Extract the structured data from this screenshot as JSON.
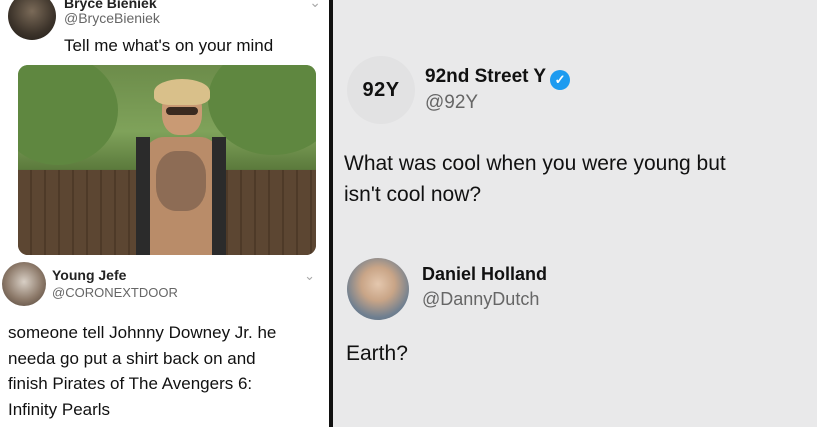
{
  "left_panel": {
    "tweet1": {
      "author_name": "Bryce Bieniek",
      "author_handle": "@BryceBieniek",
      "text": "Tell me what's on your mind",
      "menu_icon": "chevron-down-icon"
    },
    "reply": {
      "author_name": "Young Jefe",
      "author_handle": "@CORONEXTDOOR",
      "menu_icon": "chevron-down-icon",
      "text_lines": [
        "someone tell Johnny Downey Jr. he",
        "needa go put a shirt back on and",
        "finish Pirates of The Avengers 6:",
        "Infinity Pearls"
      ]
    }
  },
  "right_panel": {
    "tweet1": {
      "avatar_text": "92Y",
      "author_name": "92nd Street Y",
      "author_handle": "@92Y",
      "verified_icon": "verified-badge-icon",
      "text_lines": [
        "What was cool when you were young but",
        "isn't cool now?"
      ]
    },
    "reply": {
      "author_name": "Daniel Holland",
      "author_handle": "@DannyDutch",
      "text": "Earth?"
    }
  },
  "colors": {
    "verified_blue": "#1d9bf0",
    "right_background": "#e9e9ea",
    "handle_gray": "#666666"
  }
}
